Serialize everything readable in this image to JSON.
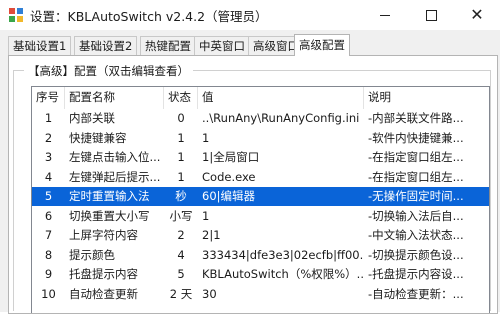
{
  "window": {
    "title": "设置：KBLAutoSwitch v2.4.2（管理员）",
    "icon_colors": [
      "#e04b3a",
      "#2f7fd6",
      "#3aa64a",
      "#f2b82a"
    ]
  },
  "window_controls": {
    "close_glyph": "✕"
  },
  "tabs": [
    {
      "label": "基础设置1"
    },
    {
      "label": "基础设置2"
    },
    {
      "label": "热键配置"
    },
    {
      "label": "中英窗口"
    },
    {
      "label": "高级窗口"
    },
    {
      "label": "高级配置"
    }
  ],
  "active_tab": "高级配置",
  "group": {
    "label": "【高级】配置（双击编辑查看）"
  },
  "table": {
    "columns": [
      "序号",
      "配置名称",
      "状态",
      "值",
      "说明"
    ],
    "rows": [
      [
        "1",
        "内部关联",
        "0",
        "..\\RunAny\\RunAnyConfig.ini",
        "-内部关联文件路..."
      ],
      [
        "2",
        "快捷键兼容",
        "1",
        "1",
        "-软件内快捷键兼..."
      ],
      [
        "3",
        "左键点击输入位...",
        "1",
        "1|全局窗口",
        "-在指定窗口组左..."
      ],
      [
        "4",
        "左键弹起后提示...",
        "1",
        "Code.exe",
        "-在指定窗口组左..."
      ],
      [
        "5",
        "定时重置输入法",
        "秒",
        "60|编辑器",
        "-无操作固定时间..."
      ],
      [
        "6",
        "切换重置大小写",
        "小写",
        "1",
        "-切换输入法后自..."
      ],
      [
        "7",
        "上屏字符内容",
        "2",
        "2|1",
        "-中文输入法状态..."
      ],
      [
        "8",
        "提示颜色",
        "4",
        "333434|dfe3e3|02ecfb|ff00...",
        "-切换提示颜色设..."
      ],
      [
        "9",
        "托盘提示内容",
        "5",
        "KBLAutoSwitch（%权限%）...",
        "-托盘提示内容设..."
      ],
      [
        "10",
        "自动检查更新",
        "2 天",
        "30",
        "-自动检查更新：..."
      ]
    ],
    "selected_row_index": 4,
    "selection_color": "#0a64d8"
  }
}
